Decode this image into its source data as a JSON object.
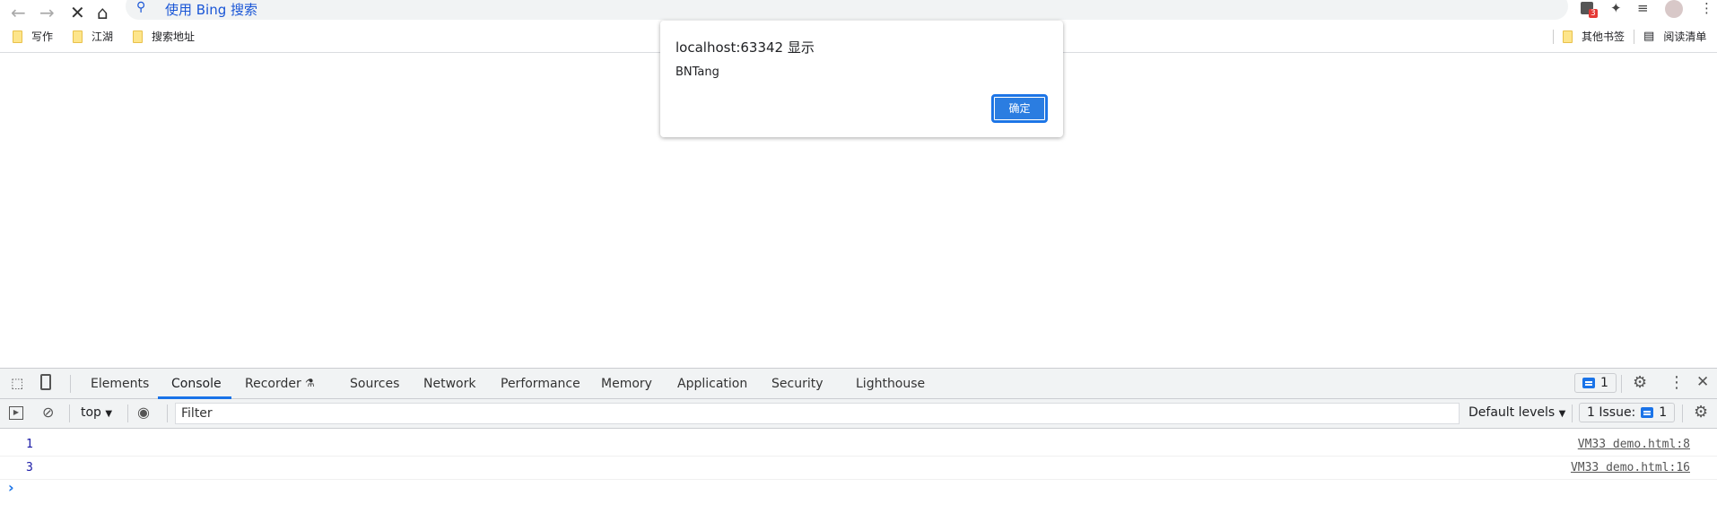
{
  "browser": {
    "omnibox_text": "使用 Bing 搜索",
    "extension_badge": "3",
    "bookmarks": [
      {
        "label": "写作"
      },
      {
        "label": "江湖"
      },
      {
        "label": "搜索地址"
      }
    ],
    "other_bookmarks": "其他书签",
    "reading_list": "阅读清单"
  },
  "dialog": {
    "title": "localhost:63342 显示",
    "message": "BNTang",
    "ok_label": "确定"
  },
  "devtools": {
    "tabs": [
      {
        "label": "Elements"
      },
      {
        "label": "Console",
        "active": true
      },
      {
        "label": "Recorder"
      },
      {
        "label": "Sources"
      },
      {
        "label": "Network"
      },
      {
        "label": "Performance"
      },
      {
        "label": "Memory"
      },
      {
        "label": "Application"
      },
      {
        "label": "Security"
      },
      {
        "label": "Lighthouse"
      }
    ],
    "issues_count": "1",
    "context": "top",
    "filter_placeholder": "Filter",
    "levels": "Default levels",
    "issue_label": "1 Issue:",
    "issue_count": "1",
    "console_rows": [
      {
        "value": "1",
        "source": "VM33 demo.html:8"
      },
      {
        "value": "3",
        "source": "VM33 demo.html:16"
      }
    ],
    "prompt": "›",
    "accent": "#1a73e8"
  }
}
